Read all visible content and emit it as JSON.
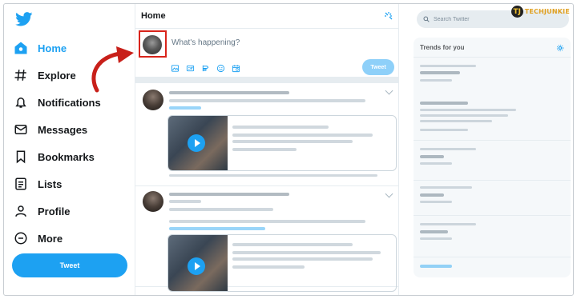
{
  "colors": {
    "brand": "#1da1f2",
    "highlight": "#d9241b",
    "arrow": "#c8201a"
  },
  "watermark": {
    "badge": "TJ",
    "text": "TECHJUNKIE"
  },
  "nav": {
    "items": [
      {
        "key": "home",
        "label": "Home",
        "icon": "home-icon",
        "active": true
      },
      {
        "key": "explore",
        "label": "Explore",
        "icon": "hashtag-icon"
      },
      {
        "key": "notifications",
        "label": "Notifications",
        "icon": "bell-icon"
      },
      {
        "key": "messages",
        "label": "Messages",
        "icon": "mail-icon"
      },
      {
        "key": "bookmarks",
        "label": "Bookmarks",
        "icon": "bookmark-icon"
      },
      {
        "key": "lists",
        "label": "Lists",
        "icon": "list-icon"
      },
      {
        "key": "profile",
        "label": "Profile",
        "icon": "user-icon"
      },
      {
        "key": "more",
        "label": "More",
        "icon": "more-icon"
      }
    ],
    "tweet_button": "Tweet"
  },
  "main": {
    "title": "Home",
    "compose": {
      "placeholder": "What's happening?",
      "tools": [
        "image-icon",
        "gif-icon",
        "poll-icon",
        "emoji-icon",
        "schedule-icon"
      ],
      "tweet_button": "Tweet"
    }
  },
  "side": {
    "search_placeholder": "Search Twitter",
    "trends_title": "Trends for you"
  }
}
